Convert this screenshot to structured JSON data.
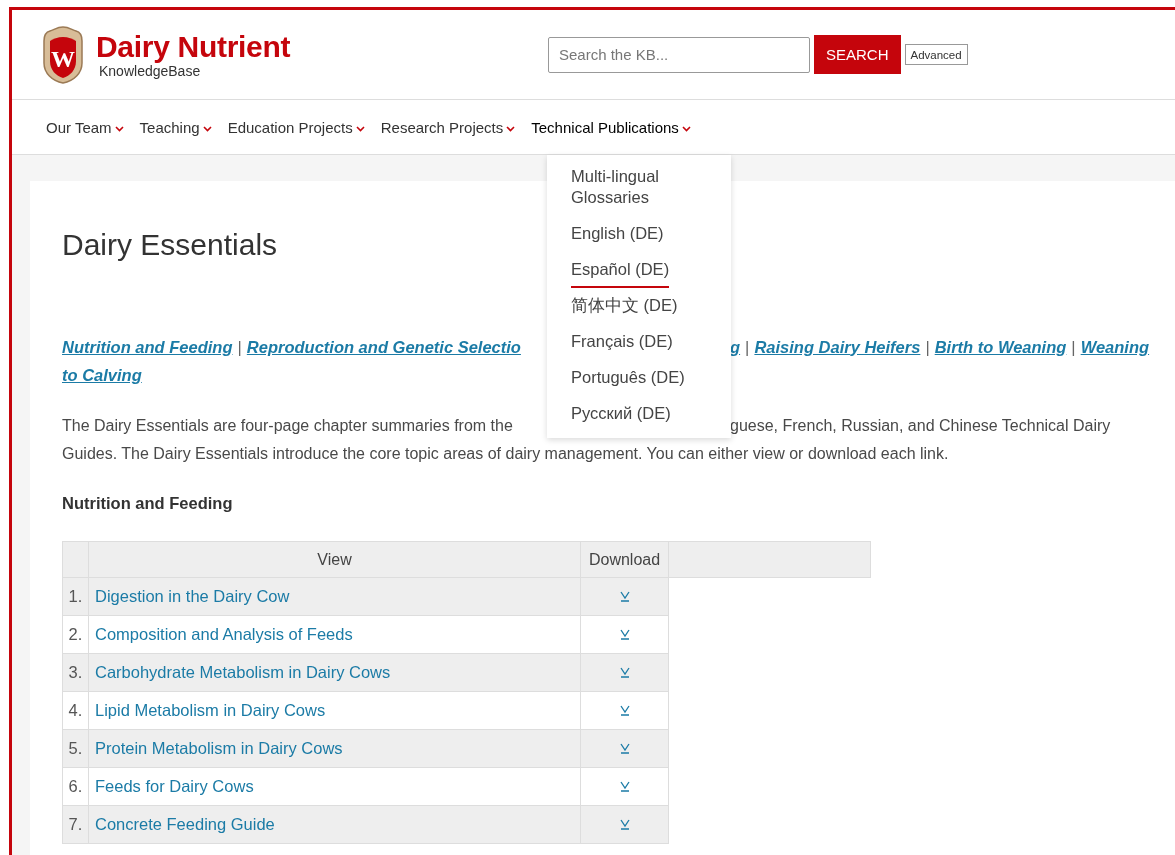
{
  "header": {
    "logo_letter": "W",
    "title": "Dairy Nutrient",
    "subtitle": "KnowledgeBase",
    "search": {
      "placeholder": "Search the KB..."
    },
    "search_button": "SEARCH",
    "advanced_button": "Advanced"
  },
  "nav": [
    {
      "label": "Our Team",
      "expanded": false
    },
    {
      "label": "Teaching",
      "expanded": false
    },
    {
      "label": "Education Projects",
      "expanded": false
    },
    {
      "label": "Research Projects",
      "expanded": false
    },
    {
      "label": "Technical Publications",
      "expanded": true
    }
  ],
  "dropdown": [
    {
      "label": "Multi-lingual Glossaries",
      "selected": false
    },
    {
      "label": "English (DE)",
      "selected": false
    },
    {
      "label": "Español (DE)",
      "selected": true
    },
    {
      "label": "简体中文 (DE)",
      "selected": false
    },
    {
      "label": "Français (DE)",
      "selected": false
    },
    {
      "label": "Português (DE)",
      "selected": false
    },
    {
      "label": "Русский (DE)",
      "selected": false
    }
  ],
  "page_title": "Dairy Essentials",
  "topic_links": {
    "left": [
      "Nutrition and Feeding",
      "Reproduction and Genetic Selectio"
    ],
    "right_fragment": "g",
    "right": [
      "Raising Dairy Heifers",
      "Birth to Weaning",
      "Weaning"
    ],
    "second_line": "to Calving",
    "separator": "|"
  },
  "intro": {
    "line_1_left": "The Dairy Essentials are four-page chapter summaries from the",
    "line_1_right": "guese, French, Russian, and Chinese Technical Dairy",
    "line_2": "Guides. The Dairy Essentials introduce the core topic areas of dairy management. You can either view or download each link."
  },
  "section_heading": "Nutrition and Feeding",
  "table": {
    "columns": [
      "View",
      "Download"
    ],
    "rows": [
      {
        "number": "1.",
        "title": "Digestion in the Dairy Cow"
      },
      {
        "number": "2.",
        "title": "Composition and Analysis of Feeds"
      },
      {
        "number": "3.",
        "title": "Carbohydrate Metabolism in Dairy Cows"
      },
      {
        "number": "4.",
        "title": "Lipid Metabolism in Dairy Cows"
      },
      {
        "number": "5.",
        "title": "Protein Metabolism in Dairy Cows"
      },
      {
        "number": "6.",
        "title": "Feeds for Dairy Cows"
      },
      {
        "number": "7.",
        "title": "Concrete Feeding Guide"
      }
    ]
  }
}
